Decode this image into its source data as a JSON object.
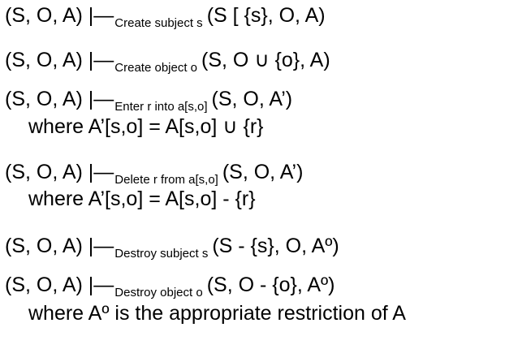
{
  "rules": [
    {
      "lhs": "(S, O, A) |",
      "op": "—",
      "label": "Create subject s",
      "rhs": "(S [ {s}, O, A)"
    },
    {
      "lhs": "(S, O, A) |",
      "op": "—",
      "label": "Create object o",
      "rhs": "(S, O ∪ {o}, A)"
    },
    {
      "lhs": "(S, O, A) |",
      "op": "—",
      "label": "Enter r into a[s,o]",
      "rhs": "(S, O, A’)",
      "where": "where A’[s,o] = A[s,o] ∪ {r}"
    },
    {
      "lhs": "(S, O, A) |",
      "op": "—",
      "label": "Delete r from a[s,o]",
      "rhs": "(S, O, A’)",
      "where": "where A’[s,o] = A[s,o] - {r}"
    },
    {
      "lhs": "(S, O, A) |",
      "op": "—",
      "label": "Destroy subject s",
      "rhs": "(S - {s}, O, Aº)"
    },
    {
      "lhs": "(S, O, A) |",
      "op": "—",
      "label": "Destroy object o",
      "rhs": "(S, O - {o}, Aº)",
      "where": "where Aº is the appropriate restriction of A"
    }
  ]
}
